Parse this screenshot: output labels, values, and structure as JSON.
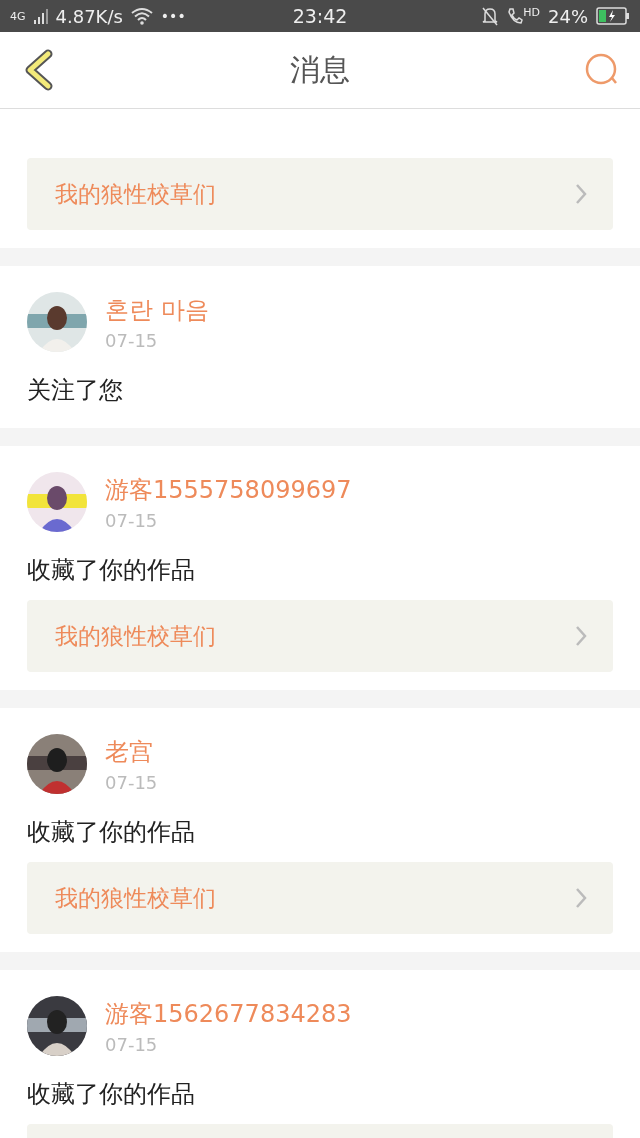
{
  "status_bar": {
    "network": "4G",
    "speed": "4.87K/s",
    "more": "•••",
    "time": "23:42",
    "call_badge": "HD",
    "battery": "24%"
  },
  "header": {
    "title": "消息"
  },
  "messages": [
    {
      "kind": "partial",
      "link": "我的狼性校草们"
    },
    {
      "kind": "full",
      "name": "혼란 마음",
      "date": "07-15",
      "text": "关注了您"
    },
    {
      "kind": "full",
      "name": "游客1555758099697",
      "date": "07-15",
      "text": "收藏了你的作品",
      "link": "我的狼性校草们"
    },
    {
      "kind": "full",
      "name": "老宫",
      "date": "07-15",
      "text": "收藏了你的作品",
      "link": "我的狼性校草们"
    },
    {
      "kind": "full",
      "name": "游客1562677834283",
      "date": "07-15",
      "text": "收藏了你的作品",
      "link_cut": true
    }
  ]
}
